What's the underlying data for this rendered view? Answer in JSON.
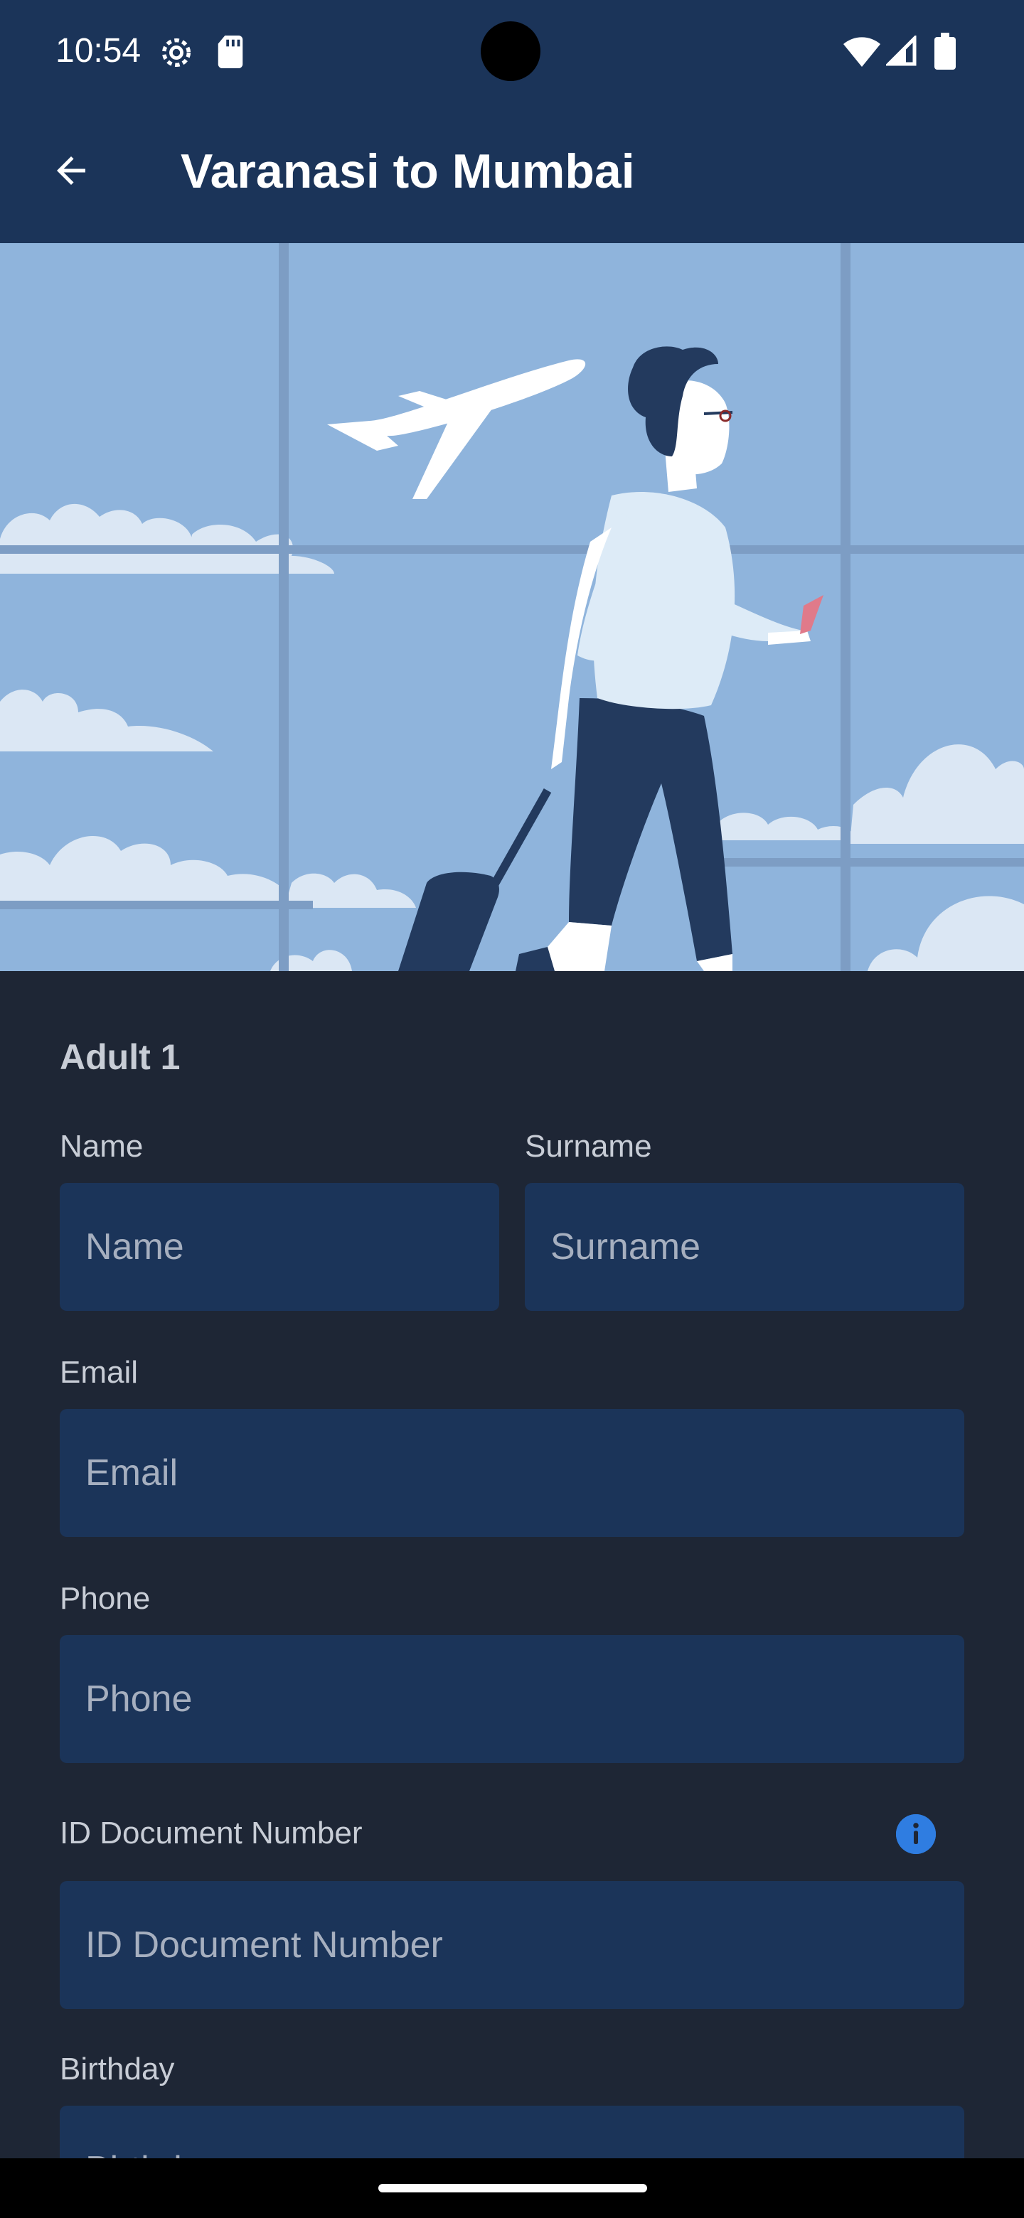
{
  "status_bar": {
    "time": "10:54",
    "icons": [
      "settings-icon",
      "sd-card-icon",
      "wifi-icon",
      "cell-signal-icon",
      "battery-icon"
    ]
  },
  "app_bar": {
    "title": "Varanasi to Mumbai",
    "back_icon": "arrow-back-icon"
  },
  "hero": {
    "illustration": "traveler-airport-illustration"
  },
  "form": {
    "section_title": "Adult 1",
    "name": {
      "label": "Name",
      "placeholder": "Name",
      "value": ""
    },
    "surname": {
      "label": "Surname",
      "placeholder": "Surname",
      "value": ""
    },
    "email": {
      "label": "Email",
      "placeholder": "Email",
      "value": ""
    },
    "phone": {
      "label": "Phone",
      "placeholder": "Phone",
      "value": ""
    },
    "id_document": {
      "label": "ID Document Number",
      "placeholder": "ID Document Number",
      "value": "",
      "info_icon": "info-icon"
    },
    "birthday": {
      "label": "Birthday",
      "placeholder": "Birthday",
      "value": ""
    }
  },
  "colors": {
    "app_bar_bg": "#1b3459",
    "page_bg": "#1e2635",
    "input_bg": "#1b3459",
    "accent": "#2f7de1",
    "hero_sky": "#8fb4dc"
  }
}
